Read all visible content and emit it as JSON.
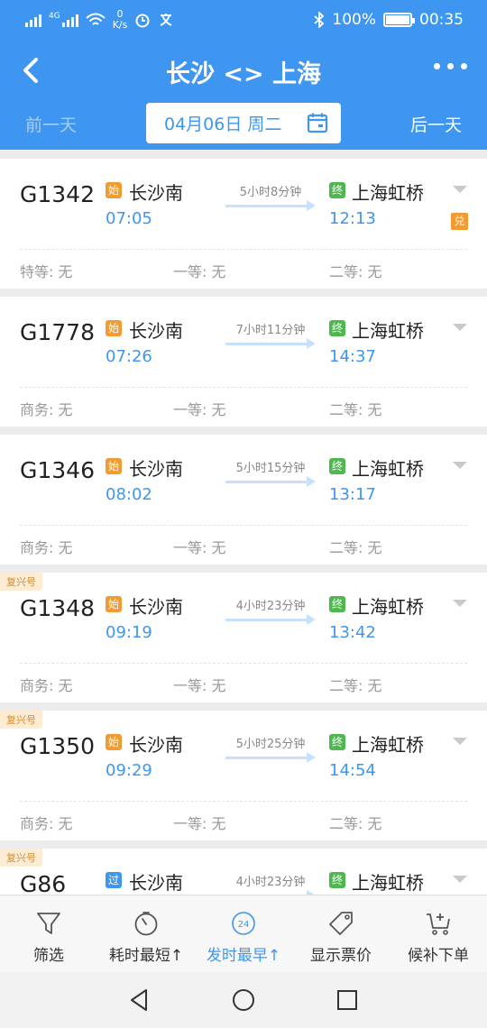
{
  "status_bar": {
    "net_label": "4G",
    "speed_value": "0",
    "speed_unit": "K/s",
    "battery_pct": "100%",
    "battery_level": 1.0,
    "time": "00:35"
  },
  "header": {
    "title": "长沙 <> 上海",
    "prev_day": "前一天",
    "next_day": "后一天",
    "date": "04月06日 周二"
  },
  "trains": [
    {
      "fx_badge": "",
      "number": "G1342",
      "from_tag": "始",
      "from": "长沙南",
      "dep": "07:05",
      "duration": "5小时8分钟",
      "to_tag": "终",
      "to": "上海虹桥",
      "arr": "12:13",
      "extra_badge": "兑",
      "seats": [
        "特等: 无",
        "一等: 无",
        "二等: 无"
      ]
    },
    {
      "fx_badge": "",
      "number": "G1778",
      "from_tag": "始",
      "from": "长沙南",
      "dep": "07:26",
      "duration": "7小时11分钟",
      "to_tag": "终",
      "to": "上海虹桥",
      "arr": "14:37",
      "extra_badge": "",
      "seats": [
        "商务: 无",
        "一等: 无",
        "二等: 无"
      ]
    },
    {
      "fx_badge": "",
      "number": "G1346",
      "from_tag": "始",
      "from": "长沙南",
      "dep": "08:02",
      "duration": "5小时15分钟",
      "to_tag": "终",
      "to": "上海虹桥",
      "arr": "13:17",
      "extra_badge": "",
      "seats": [
        "商务: 无",
        "一等: 无",
        "二等: 无"
      ]
    },
    {
      "fx_badge": "复兴号",
      "number": "G1348",
      "from_tag": "始",
      "from": "长沙南",
      "dep": "09:19",
      "duration": "4小时23分钟",
      "to_tag": "终",
      "to": "上海虹桥",
      "arr": "13:42",
      "extra_badge": "",
      "seats": [
        "商务: 无",
        "一等: 无",
        "二等: 无"
      ]
    },
    {
      "fx_badge": "复兴号",
      "number": "G1350",
      "from_tag": "始",
      "from": "长沙南",
      "dep": "09:29",
      "duration": "5小时25分钟",
      "to_tag": "终",
      "to": "上海虹桥",
      "arr": "14:54",
      "extra_badge": "",
      "seats": [
        "商务: 无",
        "一等: 无",
        "二等: 无"
      ]
    },
    {
      "fx_badge": "复兴号",
      "number": "G86",
      "from_tag": "过",
      "from": "长沙南",
      "dep": "",
      "duration": "4小时23分钟",
      "to_tag": "终",
      "to": "上海虹桥",
      "arr": "",
      "extra_badge": "",
      "seats": [
        "",
        "",
        ""
      ]
    }
  ],
  "toolbar": {
    "items": [
      {
        "label": "筛选",
        "icon": "filter-icon",
        "active": false
      },
      {
        "label": "耗时最短↑",
        "icon": "stopwatch-icon",
        "active": false
      },
      {
        "label": "发时最早↑",
        "icon": "clock-24-icon",
        "icon_text": "24",
        "active": true
      },
      {
        "label": "显示票价",
        "icon": "price-tag-icon",
        "active": false
      },
      {
        "label": "候补下单",
        "icon": "cart-plus-icon",
        "active": false
      }
    ]
  },
  "colors": {
    "primary": "#3e96f0",
    "start_tag": "#f39b31",
    "end_tag": "#4eb84f"
  }
}
